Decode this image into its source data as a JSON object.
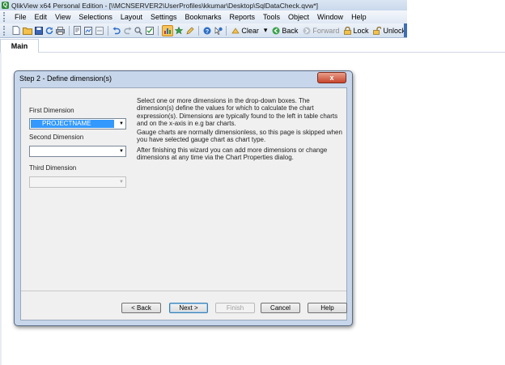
{
  "window": {
    "title": "QlikView x64 Personal Edition - [\\\\MCNSERVER2\\UserProfiles\\kkumar\\Desktop\\SqlDataCheck.qvw*]",
    "app_icon_glyph": "Q"
  },
  "menu": {
    "items": [
      "File",
      "Edit",
      "View",
      "Selections",
      "Layout",
      "Settings",
      "Bookmarks",
      "Reports",
      "Tools",
      "Object",
      "Window",
      "Help"
    ]
  },
  "toolbar": {
    "clear_label": "Clear",
    "back_label": "Back",
    "forward_label": "Forward",
    "lock_label": "Lock",
    "unlock_label": "Unlock",
    "dropdown_glyph": "▾"
  },
  "tabs": {
    "active": "Main"
  },
  "dialog": {
    "title": "Step 2 - Define dimension(s)",
    "close_glyph": "x",
    "first_dimension_label": "First Dimension",
    "first_dimension_value": "PROJECTNAME",
    "second_dimension_label": "Second Dimension",
    "second_dimension_value": "",
    "third_dimension_label": "Third Dimension",
    "third_dimension_value": "",
    "combo_arrow_glyph": "▼",
    "info_paragraph_1": "Select one or more dimensions in the drop-down boxes. The dimension(s) define the values for which to calculate the chart expression(s). Dimensions are typically found to the left in table charts and on the x-axis in e.g bar charts.",
    "info_paragraph_2": "Gauge charts are normally dimensionless, so this page is skipped when you have selected gauge chart as chart type.",
    "info_paragraph_3": "After finishing this wizard you can add more dimensions or change dimensions at any time via the Chart Properties dialog.",
    "buttons": {
      "back": "< Back",
      "next": "Next >",
      "finish": "Finish",
      "cancel": "Cancel",
      "help": "Help"
    }
  },
  "colors": {
    "selection_blue": "#3399ff",
    "dialog_frame": "#c7d6ea",
    "close_red": "#c8452d"
  }
}
